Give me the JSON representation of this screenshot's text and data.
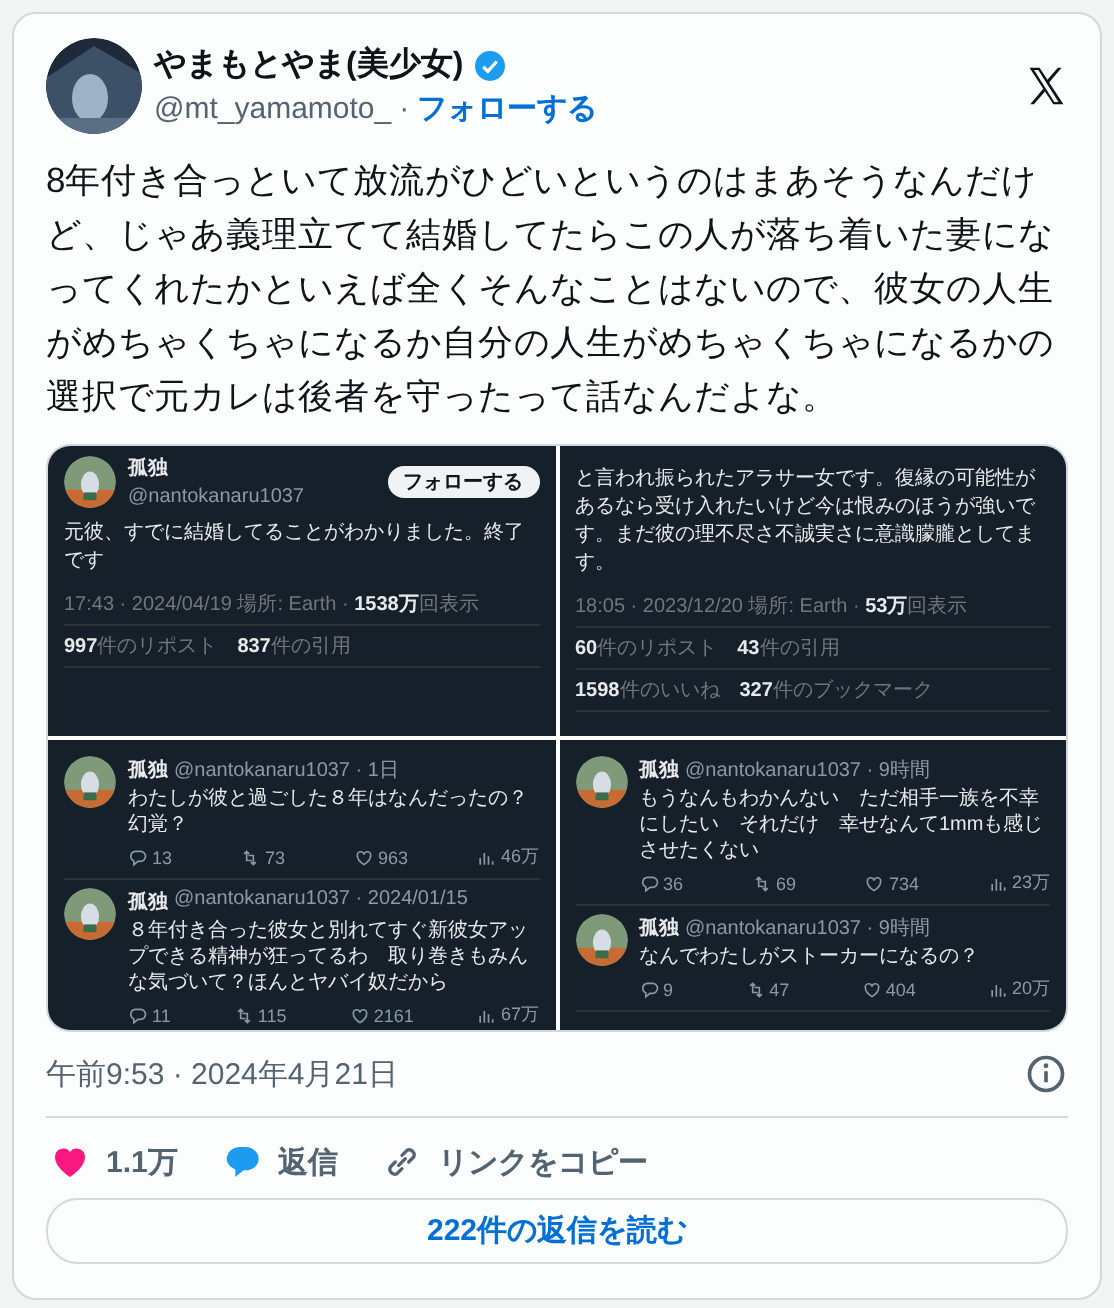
{
  "author": {
    "name": "やまもとやま(美少女)",
    "verified": true,
    "handle": "@mt_yamamoto_",
    "separator": "·",
    "follow": "フォローする"
  },
  "text": "8年付き合っといて放流がひどいというのはまあそうなんだけど、じゃあ義理立てて結婚してたらこの人が落ち着いた妻になってくれたかといえば全くそんなことはないので、彼女の人生がめちゃくちゃになるか自分の人生がめちゃくちゃになるかの選択で元カレは後者を守ったって話なんだよな。",
  "media": [
    {
      "kind": "detail",
      "name": "孤独",
      "handle": "@nantokanaru1037",
      "follow": "フォローする",
      "text": "元彼、すでに結婚してることがわかりました。終了です",
      "meta": "17:43 · 2024/04/19 場所: Earth · **1538万**回表示",
      "stats": [
        "**997**件のリポスト　**837**件の引用"
      ]
    },
    {
      "kind": "detail",
      "text": "と言われ振られたアラサー女です。復縁の可能性があるなら受け入れたいけど今は恨みのほうが強いです。まだ彼の理不尽さ不誠実さに意識朦朧としてます。",
      "meta": "18:05 · 2023/12/20 場所: Earth · **53万**回表示",
      "stats": [
        "**60**件のリポスト　**43**件の引用",
        "**1598**件のいいね　**327**件のブックマーク"
      ]
    },
    {
      "kind": "replies",
      "tweets": [
        {
          "name": "孤独",
          "byline": "@nantokanaru1037 · 1日",
          "text": "わたしが彼と過ごした８年はなんだったの？幻覚？",
          "counts": [
            "13",
            "73",
            "963",
            "46万"
          ]
        },
        {
          "name": "孤独",
          "byline": "@nantokanaru1037 · 2024/01/15",
          "text": "８年付き合った彼女と別れてすぐ新彼女アップできる精神が狂ってるわ　取り巻きもみんな気づいて？ほんとヤバイ奴だから",
          "counts": [
            "11",
            "115",
            "2161",
            "67万"
          ]
        }
      ]
    },
    {
      "kind": "replies",
      "tweets": [
        {
          "name": "孤独",
          "byline": "@nantokanaru1037 · 9時間",
          "text": "もうなんもわかんない　ただ相手一族を不幸にしたい　それだけ　幸せなんて1mmも感じさせたくない",
          "counts": [
            "36",
            "69",
            "734",
            "23万"
          ]
        },
        {
          "name": "孤独",
          "byline": "@nantokanaru1037 · 9時間",
          "text": "なんでわたしがストーカーになるの？",
          "counts": [
            "9",
            "47",
            "404",
            "20万"
          ]
        }
      ]
    }
  ],
  "timestamp": "午前9:53 · 2024年4月21日",
  "actions": [
    {
      "kind": "like",
      "label": "1.1万"
    },
    {
      "kind": "reply",
      "label": "返信"
    },
    {
      "kind": "copy",
      "label": "リンクをコピー"
    }
  ],
  "read_replies": "222件の返信を読む"
}
